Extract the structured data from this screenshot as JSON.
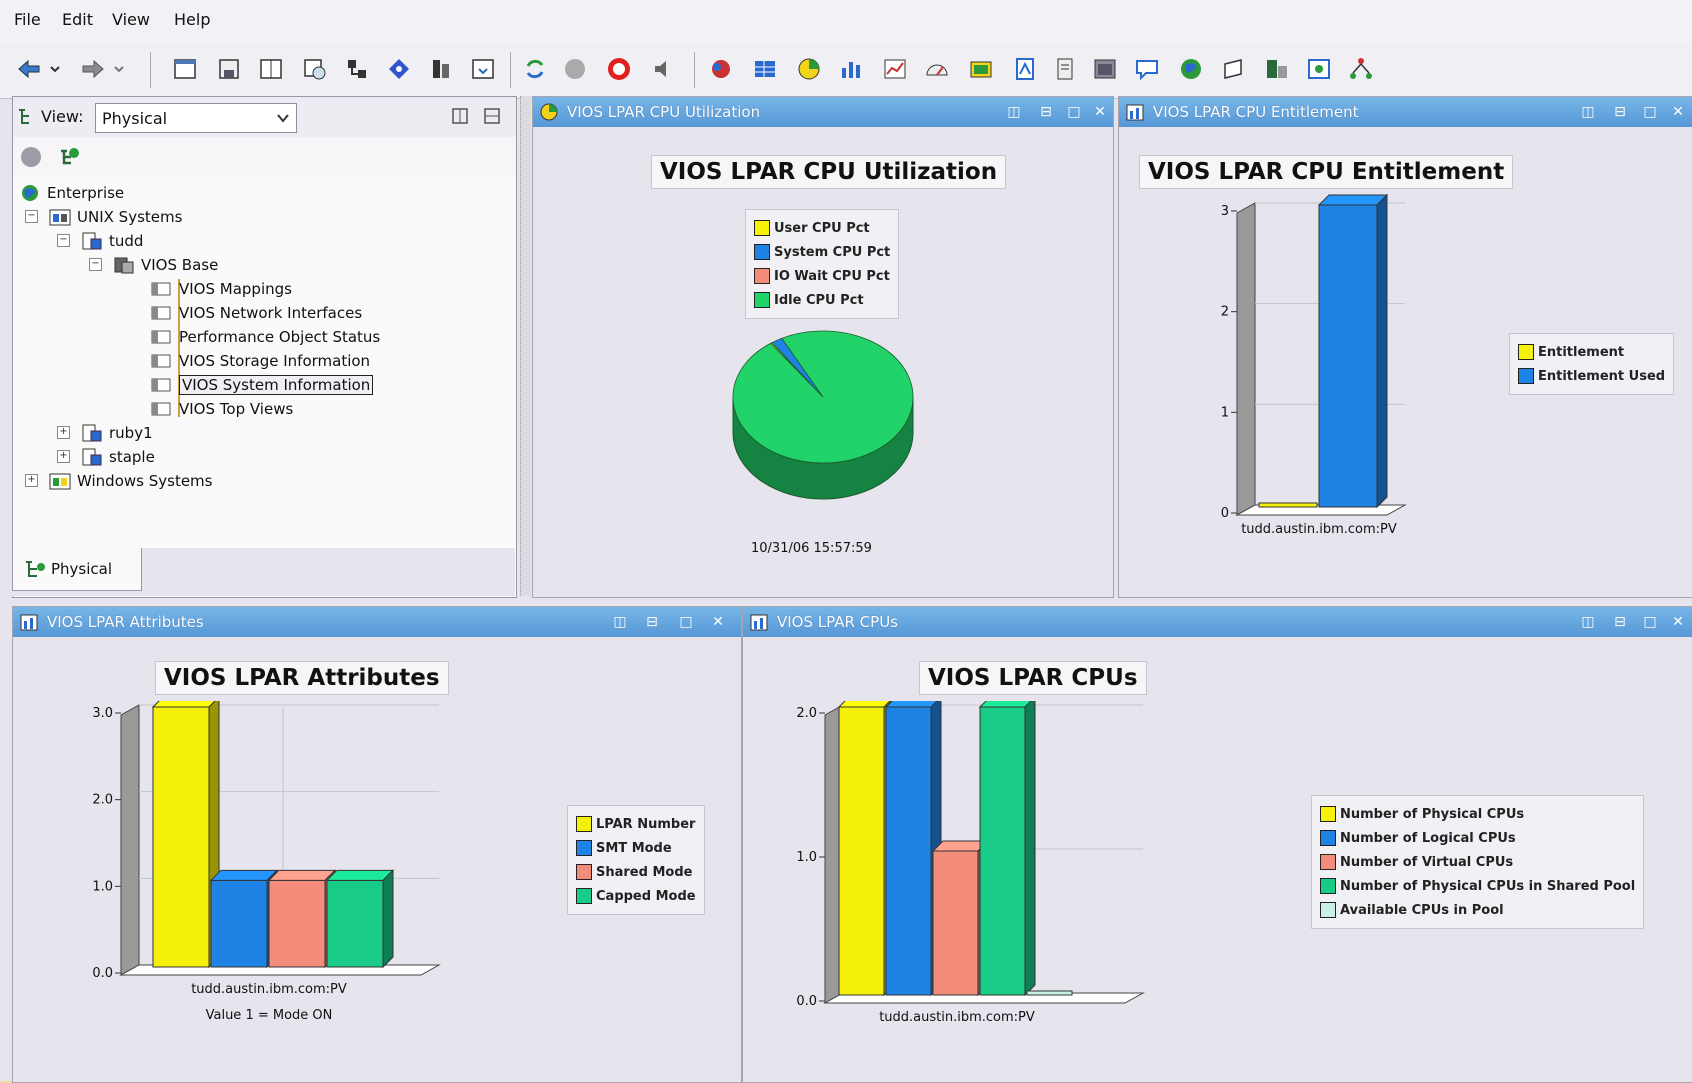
{
  "menu": [
    "File",
    "Edit",
    "View",
    "Help"
  ],
  "navigator": {
    "view_label": "View:",
    "view_value": "Physical",
    "tab_label": "Physical",
    "tree": [
      {
        "label": "Enterprise",
        "level": 0
      },
      {
        "label": "UNIX Systems",
        "level": 1
      },
      {
        "label": "tudd",
        "level": 2
      },
      {
        "label": "VIOS Base",
        "level": 3
      },
      {
        "label": "VIOS Mappings",
        "level": 4
      },
      {
        "label": "VIOS Network Interfaces",
        "level": 4
      },
      {
        "label": "Performance Object Status",
        "level": 4
      },
      {
        "label": "VIOS Storage Information",
        "level": 4
      },
      {
        "label": "VIOS System Information",
        "level": 4
      },
      {
        "label": "VIOS Top Views",
        "level": 4
      },
      {
        "label": "ruby1",
        "level": 2
      },
      {
        "label": "staple",
        "level": 2
      },
      {
        "label": "Windows Systems",
        "level": 1
      }
    ],
    "selected": "VIOS System Information"
  },
  "panels": {
    "cpu_util": {
      "header": "VIOS LPAR CPU Utilization"
    },
    "cpu_ent": {
      "header": "VIOS LPAR CPU Entitlement"
    },
    "attrs": {
      "header": "VIOS LPAR Attributes"
    },
    "cpus": {
      "header": "VIOS LPAR CPUs"
    }
  },
  "colors": {
    "yellow": "#f5f10a",
    "blue": "#1f83e6",
    "salmon": "#f48c7c",
    "green": "#18cc88",
    "pie_green": "#22d36a",
    "light_cyan": "#c8f0e6",
    "header_blue": "#5b9bd8"
  },
  "chart_data": [
    {
      "type": "pie",
      "title": "VIOS LPAR CPU Utilization",
      "categories": [
        "User CPU Pct",
        "System CPU Pct",
        "IO Wait CPU Pct",
        "Idle CPU Pct"
      ],
      "values": [
        0.3,
        2,
        0,
        97.7
      ],
      "colors": [
        "#f5f10a",
        "#1f83e6",
        "#f48c7c",
        "#22d36a"
      ],
      "caption": "10/31/06 15:57:59"
    },
    {
      "type": "bar",
      "title": "VIOS LPAR CPU Entitlement",
      "categories": [
        "tudd.austin.ibm.com:PV"
      ],
      "series": [
        {
          "name": "Entitlement",
          "values": [
            0
          ]
        },
        {
          "name": "Entitlement Used",
          "values": [
            3
          ]
        }
      ],
      "ylim": [
        0,
        3
      ],
      "yticks": [
        "0",
        "1",
        "2",
        "3"
      ],
      "legend": "right"
    },
    {
      "type": "bar",
      "title": "VIOS LPAR Attributes",
      "categories": [
        "tudd.austin.ibm.com:PV"
      ],
      "series": [
        {
          "name": "LPAR Number",
          "values": [
            3
          ]
        },
        {
          "name": "SMT Mode",
          "values": [
            1
          ]
        },
        {
          "name": "Shared Mode",
          "values": [
            1
          ]
        },
        {
          "name": "Capped Mode",
          "values": [
            1
          ]
        }
      ],
      "ylim": [
        0,
        3
      ],
      "yticks": [
        "0.0",
        "1.0",
        "2.0",
        "3.0"
      ],
      "note": "Value 1 = Mode ON",
      "legend": "right"
    },
    {
      "type": "bar",
      "title": "VIOS LPAR CPUs",
      "categories": [
        "tudd.austin.ibm.com:PV"
      ],
      "series": [
        {
          "name": "Number of Physical CPUs",
          "values": [
            2
          ]
        },
        {
          "name": "Number of Logical CPUs",
          "values": [
            2
          ]
        },
        {
          "name": "Number of Virtual CPUs",
          "values": [
            1
          ]
        },
        {
          "name": "Number of Physical CPUs in Shared Pool",
          "values": [
            2
          ]
        },
        {
          "name": "Available CPUs in Pool",
          "values": [
            0
          ]
        }
      ],
      "ylim": [
        0,
        2
      ],
      "yticks": [
        "0.0",
        "1.0",
        "2.0"
      ],
      "legend": "right"
    }
  ]
}
